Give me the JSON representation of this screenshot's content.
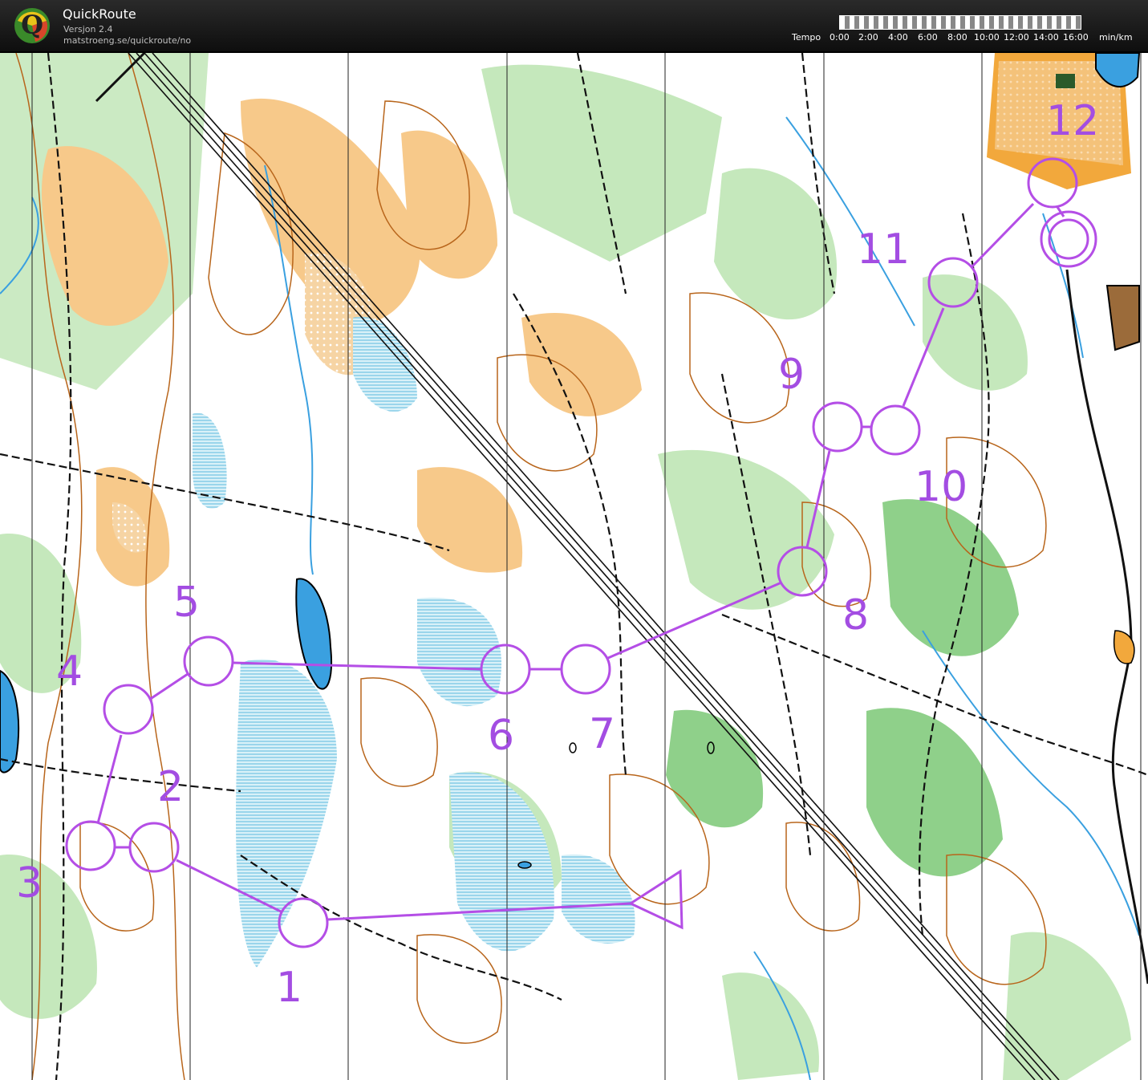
{
  "header": {
    "app_title": "QuickRoute",
    "app_version": "Versjon 2.4",
    "app_url": "matstroeng.se/quickroute/no",
    "logo_letter": "Q"
  },
  "pace_scale": {
    "label": "Tempo",
    "ticks": [
      "0:00",
      "2:00",
      "4:00",
      "6:00",
      "8:00",
      "10:00",
      "12:00",
      "14:00",
      "16:00"
    ],
    "unit": "min/km"
  },
  "course": {
    "color": "#b44ee6",
    "controls": [
      {
        "label": "1"
      },
      {
        "label": "2"
      },
      {
        "label": "3"
      },
      {
        "label": "4"
      },
      {
        "label": "5"
      },
      {
        "label": "6"
      },
      {
        "label": "7"
      },
      {
        "label": "8"
      },
      {
        "label": "9"
      },
      {
        "label": "10"
      },
      {
        "label": "11"
      },
      {
        "label": "12"
      }
    ]
  },
  "map_colors": {
    "forest_green": "#8fd08a",
    "light_green": "#c5e8bc",
    "open_yellow": "#f7c98a",
    "water_blue": "#3aa0e0",
    "marsh_blue": "#9fd8ee",
    "contour_brown": "#b8651b",
    "path_black": "#111111"
  }
}
